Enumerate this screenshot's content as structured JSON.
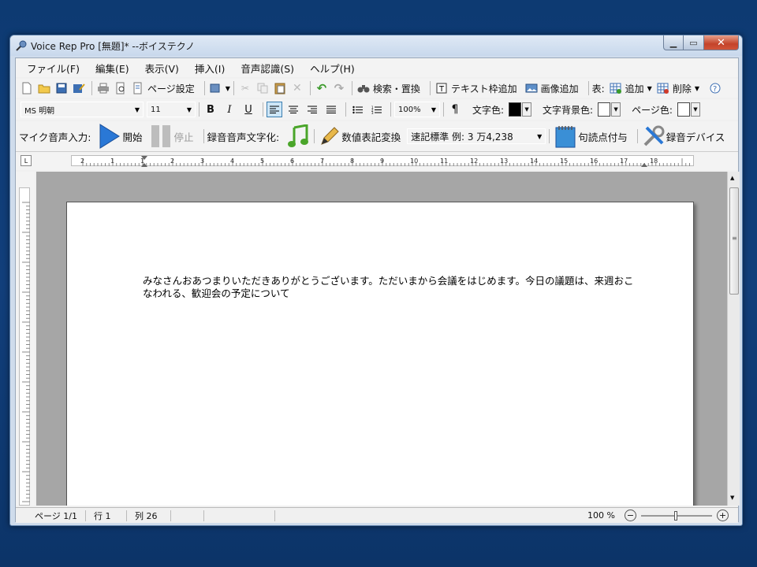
{
  "window": {
    "title": "Voice Rep Pro [無題]* --ボイステクノ"
  },
  "menu": [
    "ファイル(F)",
    "編集(E)",
    "表示(V)",
    "挿入(I)",
    "音声認識(S)",
    "ヘルプ(H)"
  ],
  "toolbar1": {
    "page_setup": "ページ設定",
    "search_replace": "検索・置換",
    "add_textbox": "テキスト枠追加",
    "add_image": "画像追加",
    "table_label": "表:",
    "table_add": "追加",
    "table_delete": "削除"
  },
  "toolbar2": {
    "font_name": "MS 明朝",
    "font_size": "11",
    "zoom": "100%",
    "text_color_label": "文字色:",
    "text_bg_color_label": "文字背景色:",
    "page_color_label": "ページ色:",
    "text_color": "#000000",
    "text_bg_color": "#ffffff",
    "page_color": "#ffffff"
  },
  "toolbar3": {
    "mic_label": "マイク音声入力:",
    "start": "開始",
    "stop": "停止",
    "transcribe_label": "録音音声文字化:",
    "number_convert": "数値表記変換",
    "number_mode": "速記標準 例: 3 万4,238",
    "punctuation": "句読点付与",
    "rec_device": "録音デバイス"
  },
  "ruler": {
    "marks": [
      "2",
      "1",
      "1",
      "2",
      "3",
      "4",
      "5",
      "6",
      "7",
      "8",
      "9",
      "10",
      "11",
      "12",
      "13",
      "14",
      "15",
      "16",
      "17",
      "18"
    ]
  },
  "document": {
    "text": "みなさんおあつまりいただきありがとうございます。ただいまから会議をはじめます。今日の議題は、来週おこなわれる、歓迎会の予定について"
  },
  "status": {
    "page": "ページ 1/1",
    "line": "行 1",
    "column": "列 26",
    "zoom": "100 %"
  }
}
